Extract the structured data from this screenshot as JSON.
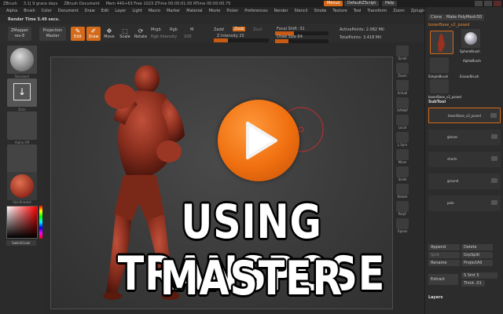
{
  "app": {
    "name": "ZBrush",
    "version_info": "3.1| 9 grace days",
    "document": "ZBrush Document",
    "stats": "Mem 440+63  Free 1023  ZTime 00:00:01.05  RTime 00:00:00.75",
    "menus_label": "Menus",
    "script_label": "DefaultZScript",
    "help_label": "Help"
  },
  "menubar": [
    "Alpha",
    "Brush",
    "Color",
    "Document",
    "Draw",
    "Edit",
    "Layer",
    "Light",
    "Macro",
    "Marker",
    "Material",
    "Movie",
    "Picker",
    "Preferences",
    "Render",
    "Stencil",
    "Stroke",
    "Texture",
    "Tool",
    "Transform",
    "Zoom",
    "Zplugin",
    "Zscript"
  ],
  "render_time": "Render Time 5.49 secs.",
  "toolbar": {
    "zmapper": "ZMapper",
    "zmapper_sub": "rev-E",
    "projection": "Projection",
    "projection_sub": "Master",
    "edit": "Edit",
    "draw": "Draw",
    "move": "Move",
    "scale": "Scale",
    "rotate": "Rotate",
    "mrgb": "Mrgb",
    "rgb": "Rgb",
    "m": "M",
    "rgb_intensity": "Rgb Intensity",
    "rgb_intensity_value": "100",
    "zadd": "Zadd",
    "zsub": "Zsub",
    "zcut": "Zcut",
    "z_intensity_label": "Z Intensity",
    "z_intensity_value": "25",
    "z_intensity_level": 0.25,
    "focal_shift_label": "Focal Shift",
    "focal_shift_value": "-31",
    "draw_size_label": "Draw Size",
    "draw_size_value": "64",
    "active_points_label": "ActivePoints:",
    "active_points_value": "2.082 Mil",
    "total_points_label": "TotalPoints:",
    "total_points_value": "3.418 Mil"
  },
  "left_panel": {
    "brush_label": "Standard",
    "stroke_label": "Dots",
    "alpha_label": "Alpha Off",
    "texture_label": "Texture Off",
    "material_label": "SkinShade4",
    "switch_color": "SwitchColor"
  },
  "right_strip": [
    {
      "label": "Scroll"
    },
    {
      "label": "Zoom"
    },
    {
      "label": "Actual"
    },
    {
      "label": "AAHalf"
    },
    {
      "label": "Local"
    },
    {
      "label": "L.Sym"
    },
    {
      "label": "Move"
    },
    {
      "label": "Scale"
    },
    {
      "label": "Rotate"
    },
    {
      "label": "PolyF"
    },
    {
      "label": "Xpose"
    }
  ],
  "tool_panel": {
    "clone": "Clone",
    "make_polymesh": "Make PolyMesh3D",
    "tool_name": "boxerBase_v2_posed",
    "sphere_brush": "SphereBrush",
    "alpha_brush": "AlphaBrush",
    "simple_brush": "SimpleBrush",
    "eraser_brush": "EraserBrush",
    "subtool_header": "SubTool",
    "subtools": [
      "boxerBase_v2_posed",
      "gloves",
      "shorts",
      "ground",
      "pole"
    ],
    "append": "Append",
    "delete": "Delete",
    "split": "Split",
    "grp_split": "GrpSplit",
    "rename": "Rename",
    "project_all": "ProjectAll",
    "extract": "Extract",
    "smt": "S Smt 5",
    "thick": "Thick .01",
    "layers": "Layers"
  },
  "overlay": {
    "line1": "USING TRANSPOSE",
    "line2": "MASTER"
  },
  "colors": {
    "accent": "#d46a1a",
    "play": "#ef6f0f",
    "figure": "#8a2e1e"
  }
}
